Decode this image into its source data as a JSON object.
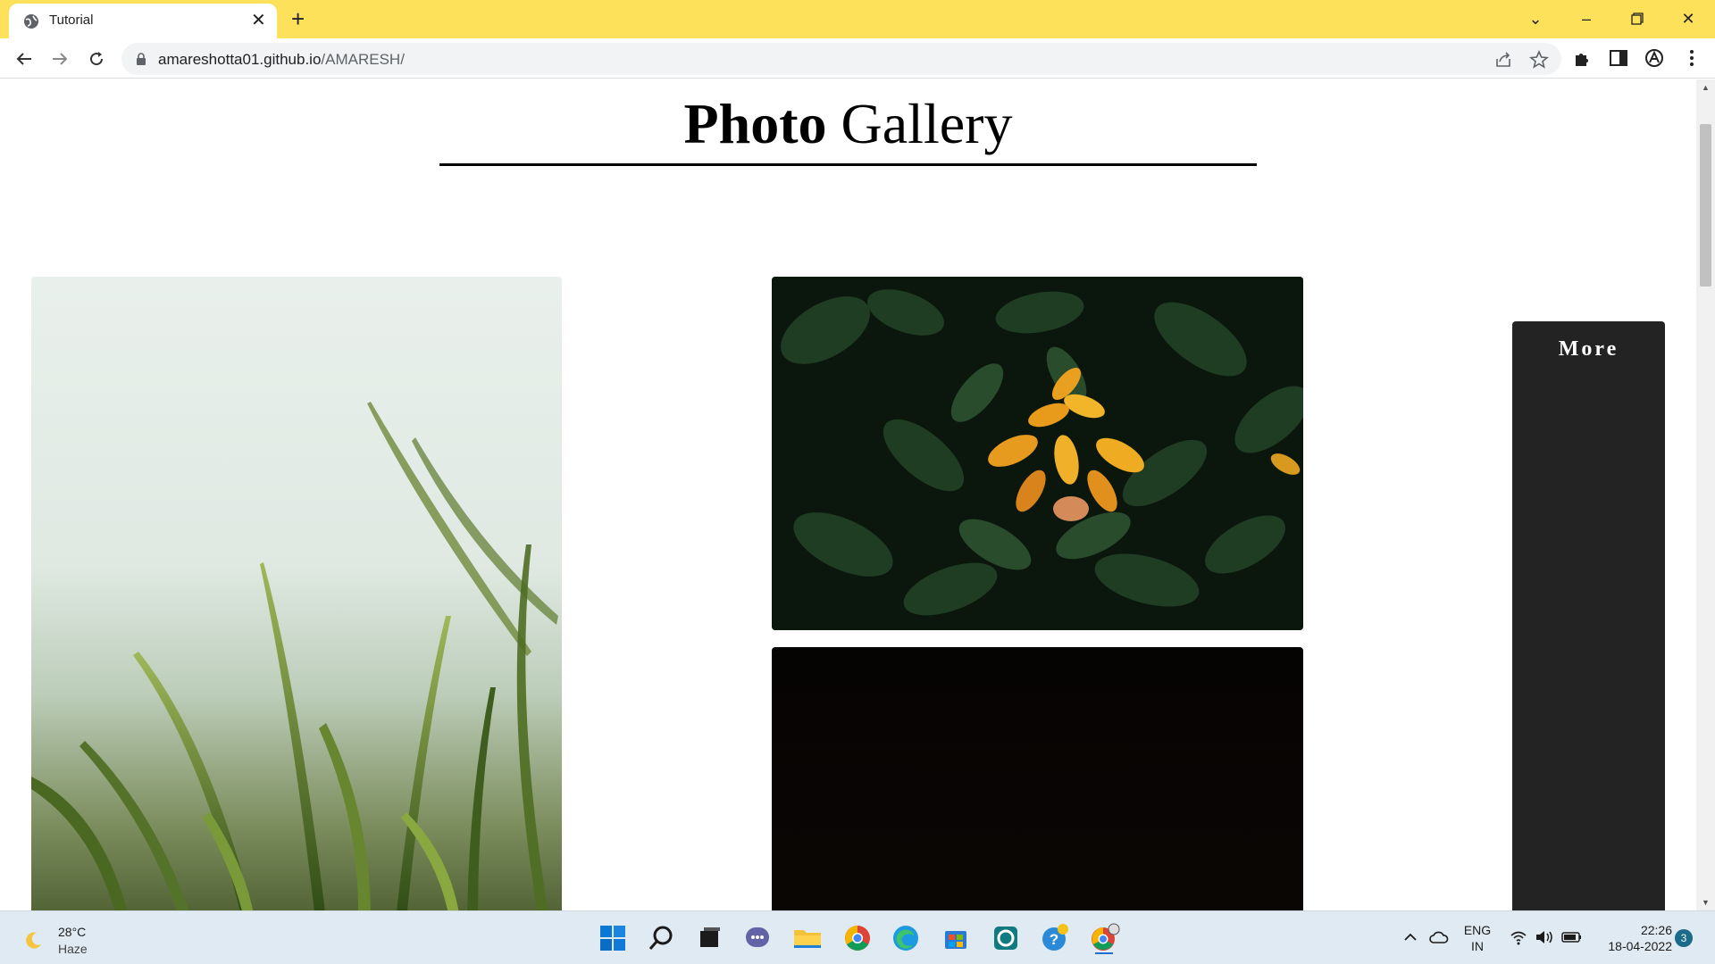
{
  "browser": {
    "tab_title": "Tutorial",
    "url_host": "amareshotta01.github.io",
    "url_path": "/AMARESH/",
    "accent": "#fde15a"
  },
  "page": {
    "title_bold": "Photo",
    "title_regular": "Gallery",
    "more_label": "More",
    "photos": [
      {
        "id": "grass",
        "subject": "green grass blades with misty background"
      },
      {
        "id": "flower",
        "subject": "orange flower among dark green leaves"
      },
      {
        "id": "dark",
        "subject": "dark image"
      }
    ]
  },
  "taskbar": {
    "weather_temp": "28°C",
    "weather_cond": "Haze",
    "lang_line1": "ENG",
    "lang_line2": "IN",
    "time": "22:26",
    "date": "18-04-2022",
    "notification_count": "3"
  }
}
